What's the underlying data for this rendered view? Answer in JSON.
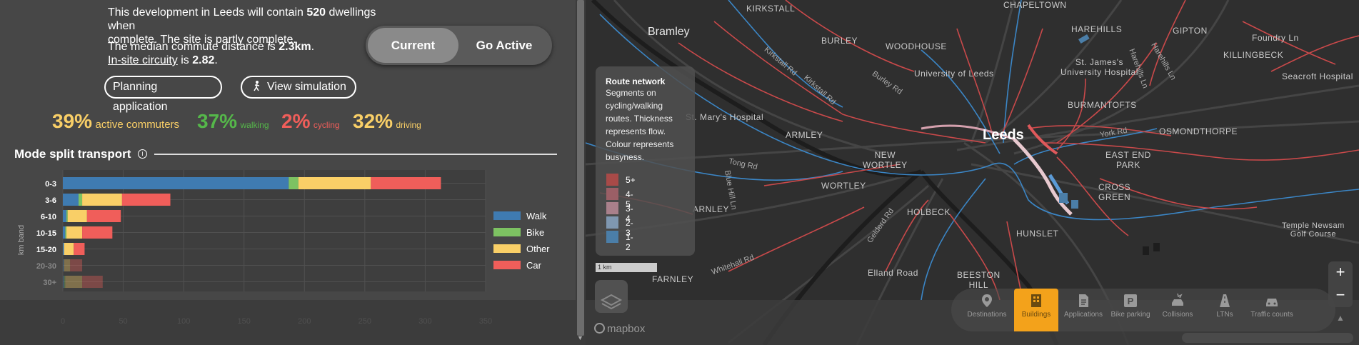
{
  "summary": {
    "line1_pre": "This development in Leeds will contain ",
    "dwellings": "520",
    "line1_post": " dwellings when",
    "line1b": "complete. The site is partly complete.",
    "commute_pre": "The median commute distance is ",
    "commute_value": "2.3km",
    "commute_post": ".",
    "circuity_link": "In-site circuity",
    "circuity_pre": " is ",
    "circuity_value": "2.82",
    "circuity_post": "."
  },
  "toggle": {
    "current": "Current",
    "go_active": "Go Active",
    "selected": "Current"
  },
  "buttons": {
    "planning": "Planning application",
    "simulation": "View simulation"
  },
  "stats": {
    "active_value": "39%",
    "active_label": "active commuters",
    "walk_value": "37%",
    "walk_label": "walking",
    "cycle_value": "2%",
    "cycle_label": "cycling",
    "drive_value": "32%",
    "drive_label": "driving"
  },
  "mode_split": {
    "heading": "Mode split transport",
    "info_icon": "info-icon"
  },
  "colors": {
    "walk": "#3f7bb1",
    "bike": "#7dc262",
    "other": "#f9cf67",
    "car": "#f05e5a",
    "accent": "#f3a21b"
  },
  "chart_data": {
    "type": "bar",
    "orientation": "horizontal",
    "stacked": true,
    "ylabel": "km band",
    "xlabel": "",
    "xlim": [
      0,
      350
    ],
    "x_ticks": [
      "0",
      "50",
      "100",
      "150",
      "200",
      "250",
      "300",
      "350"
    ],
    "categories": [
      "0-3",
      "3-6",
      "6-10",
      "10-15",
      "15-20",
      "20-30",
      "30+"
    ],
    "series": [
      {
        "name": "Walk",
        "values": [
          187,
          13,
          3,
          2,
          1,
          1,
          1
        ]
      },
      {
        "name": "Bike",
        "values": [
          8,
          3,
          1,
          1,
          0,
          0,
          1
        ]
      },
      {
        "name": "Other",
        "values": [
          60,
          33,
          16,
          13,
          8,
          5,
          14
        ]
      },
      {
        "name": "Car",
        "values": [
          58,
          40,
          28,
          25,
          9,
          10,
          17
        ]
      }
    ],
    "legend_position": "right",
    "grid": true
  },
  "map": {
    "places": {
      "kirkstall": "KIRKSTALL",
      "bramley": "Bramley",
      "burley": "BURLEY",
      "woodhouse": "WOODHOUSE",
      "harehills": "HAREHILLS",
      "gipton": "GIPTON",
      "killingbeck": "KILLINGBECK",
      "foundry": "Foundry Ln",
      "seacroft": "Seacroft Hospital",
      "st_james": "St. James's\nUniversity Hospital",
      "uni": "University of Leeds",
      "burmantofts": "BURMANTOFTS",
      "st_marys": "St. Mary's Hospital",
      "armley": "ARMLEY",
      "leeds": "Leeds",
      "osmondthorpe": "OSMONDTHORPE",
      "new_wortley": "NEW\nWORTLEY",
      "east_end_park": "EAST END\nPARK",
      "wortley": "WORTLEY",
      "cross_green": "CROSS\nGREEN",
      "holbeck": "HOLBECK",
      "hunslet": "HUNSLET",
      "farnley_mid": "ARNLEY",
      "temple_newsam": "Temple Newsam\nGolf Course",
      "farnley": "FARNLEY",
      "elland": "Elland Road",
      "beeston_hill": "BEESTON\nHILL",
      "chapeltown": "CHAPELTOWN"
    },
    "roads": {
      "kirkstall_rd": "Kirkstall Rd",
      "burley_rd": "Burley Rd",
      "kirkstall_rd2": "Kirkstall Rd",
      "york_rd": "York Rd",
      "tong_rd": "Tong Rd",
      "whitehall_rd": "Whitehall Rd",
      "gelderd_rd": "Gelderd Rd",
      "blue_hill_ln": "Blue Hill Ln",
      "harehills_ln": "Harehills Ln",
      "harehills_ln2": "Harehills Ln"
    },
    "legend": {
      "title": "Route network",
      "description": "Segments on cycling/walking routes. Thickness represents flow. Colour represents busyness.",
      "items": [
        {
          "label": "5+",
          "color": "#a84a48"
        },
        {
          "label": "4-5",
          "color": "#9b5f66"
        },
        {
          "label": "3-4",
          "color": "#a9808b"
        },
        {
          "label": "2-3",
          "color": "#7f97b0"
        },
        {
          "label": "1-2",
          "color": "#4b7ea8"
        }
      ]
    },
    "scale_label": "1 km",
    "logo": "mapbox",
    "zoom_in": "+",
    "zoom_out": "−",
    "compass": "▲",
    "tools": [
      {
        "label": "Destinations",
        "icon": "pin-icon",
        "active": false
      },
      {
        "label": "Buildings",
        "icon": "building-icon",
        "active": true
      },
      {
        "label": "Applications",
        "icon": "document-icon",
        "active": false
      },
      {
        "label": "Bike parking",
        "icon": "parking-icon",
        "active": false
      },
      {
        "label": "Collisions",
        "icon": "collision-icon",
        "active": false
      },
      {
        "label": "LTNs",
        "icon": "ltn-icon",
        "active": false
      },
      {
        "label": "Traffic counts",
        "icon": "car-icon",
        "active": false
      }
    ]
  }
}
